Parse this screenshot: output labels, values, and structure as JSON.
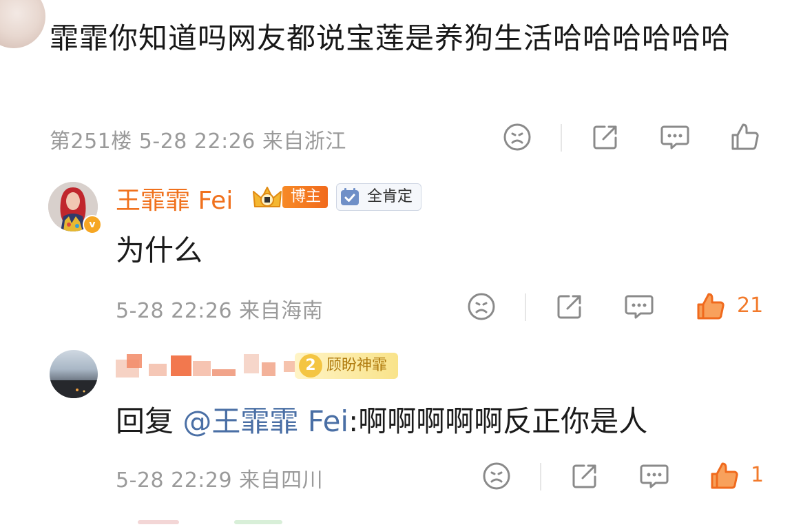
{
  "comment_251": {
    "text": "霏霏你知道吗网友都说宝莲是养狗生活哈哈哈哈哈哈",
    "meta": "第251楼 5-28 22:26 来自浙江",
    "actions": {
      "dislike_icon": "frown-face-icon",
      "share_icon": "share-icon",
      "comment_icon": "comment-icon",
      "like_icon": "thumbs-up-icon"
    }
  },
  "reply_fei": {
    "username": "王霏霏 Fei",
    "badge_bozhu": "博主",
    "badge_qkd": "全肯定",
    "text": "为什么",
    "meta": "5-28 22:26 来自海南",
    "like_count": "21",
    "colors": {
      "username": "#f0711d",
      "like_active": "#f27a2b"
    }
  },
  "reply_user": {
    "fan_level": "2",
    "fan_badge": "顾盼神霏",
    "text_prefix": "回复 ",
    "mention": "@王霏霏 Fei",
    "text_suffix": ":啊啊啊啊啊反正你是人",
    "meta": "5-28 22:29 来自四川",
    "like_count": "1",
    "colors": {
      "mention": "#4a6fa5"
    }
  }
}
